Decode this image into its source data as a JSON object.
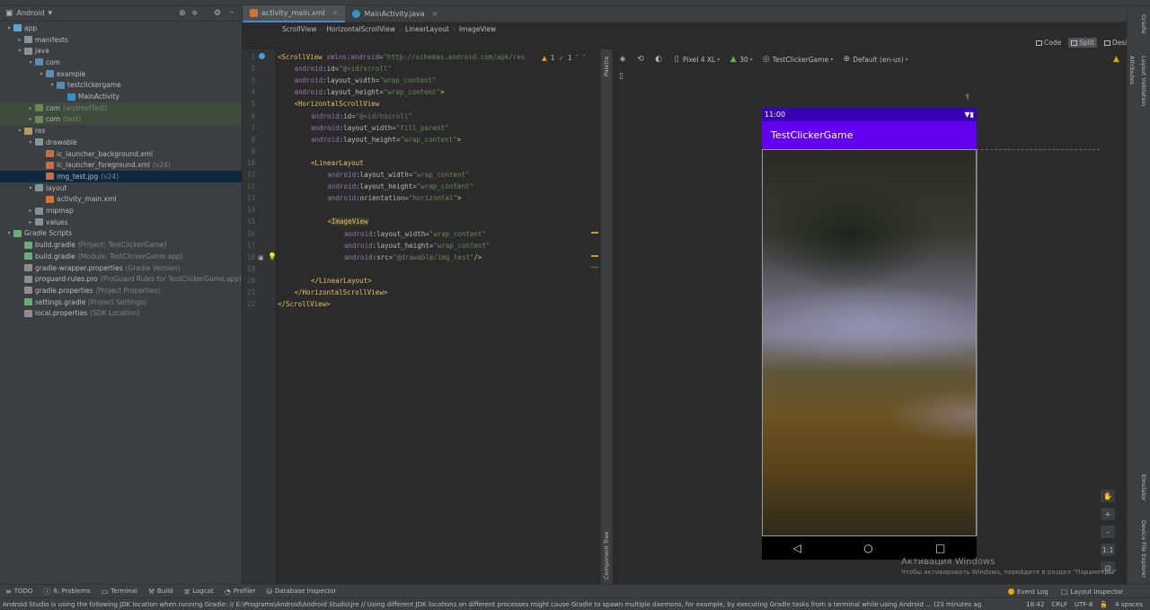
{
  "project_panel": {
    "view_selector": "Android",
    "tree": [
      {
        "label": "app",
        "sub": "",
        "depth": 0,
        "arrow": "▾",
        "icon": "app"
      },
      {
        "label": "manifests",
        "sub": "",
        "depth": 1,
        "arrow": "▸",
        "icon": "folder"
      },
      {
        "label": "java",
        "sub": "",
        "depth": 1,
        "arrow": "▾",
        "icon": "folder"
      },
      {
        "label": "com",
        "sub": "",
        "depth": 2,
        "arrow": "▾",
        "icon": "java"
      },
      {
        "label": "example",
        "sub": "",
        "depth": 3,
        "arrow": "▾",
        "icon": "java"
      },
      {
        "label": "testclickergame",
        "sub": "",
        "depth": 4,
        "arrow": "▾",
        "icon": "java"
      },
      {
        "label": "MainActivity",
        "sub": "",
        "depth": 5,
        "arrow": "",
        "icon": "class"
      },
      {
        "label": "com",
        "sub": "(androidTest)",
        "depth": 2,
        "arrow": "▸",
        "icon": "test",
        "hl": "green"
      },
      {
        "label": "com",
        "sub": "(test)",
        "depth": 2,
        "arrow": "▸",
        "icon": "test",
        "hl": "green"
      },
      {
        "label": "res",
        "sub": "",
        "depth": 1,
        "arrow": "▾",
        "icon": "res"
      },
      {
        "label": "drawable",
        "sub": "",
        "depth": 2,
        "arrow": "▾",
        "icon": "folder"
      },
      {
        "label": "ic_launcher_background.xml",
        "sub": "",
        "depth": 3,
        "arrow": "",
        "icon": "img"
      },
      {
        "label": "ic_launcher_foreground.xml",
        "sub": "(v24)",
        "depth": 3,
        "arrow": "",
        "icon": "img"
      },
      {
        "label": "img_test.jpg",
        "sub": "(v24)",
        "depth": 3,
        "arrow": "",
        "icon": "img",
        "hl": "blue"
      },
      {
        "label": "layout",
        "sub": "",
        "depth": 2,
        "arrow": "▾",
        "icon": "folder"
      },
      {
        "label": "activity_main.xml",
        "sub": "",
        "depth": 3,
        "arrow": "",
        "icon": "xml"
      },
      {
        "label": "mipmap",
        "sub": "",
        "depth": 2,
        "arrow": "▸",
        "icon": "folder"
      },
      {
        "label": "values",
        "sub": "",
        "depth": 2,
        "arrow": "▸",
        "icon": "folder"
      },
      {
        "label": "Gradle Scripts",
        "sub": "",
        "depth": 0,
        "arrow": "▾",
        "icon": "gradle"
      },
      {
        "label": "build.gradle",
        "sub": "(Project: TestClickerGame)",
        "depth": 1,
        "arrow": "",
        "icon": "gradle"
      },
      {
        "label": "build.gradle",
        "sub": "(Module: TestClickerGame.app)",
        "depth": 1,
        "arrow": "",
        "icon": "gradle"
      },
      {
        "label": "gradle-wrapper.properties",
        "sub": "(Gradle Version)",
        "depth": 1,
        "arrow": "",
        "icon": "props"
      },
      {
        "label": "proguard-rules.pro",
        "sub": "(ProGuard Rules for TestClickerGame.app)",
        "depth": 1,
        "arrow": "",
        "icon": "props"
      },
      {
        "label": "gradle.properties",
        "sub": "(Project Properties)",
        "depth": 1,
        "arrow": "",
        "icon": "props"
      },
      {
        "label": "settings.gradle",
        "sub": "(Project Settings)",
        "depth": 1,
        "arrow": "",
        "icon": "gradle"
      },
      {
        "label": "local.properties",
        "sub": "(SDK Location)",
        "depth": 1,
        "arrow": "",
        "icon": "props"
      }
    ]
  },
  "tabs": [
    {
      "label": "activity_main.xml",
      "icon": "xml",
      "active": true
    },
    {
      "label": "MainActivity.java",
      "icon": "java",
      "active": false
    }
  ],
  "breadcrumb": [
    "ScrollView",
    "HorizontalScrollView",
    "LinearLayout",
    "ImageView"
  ],
  "view_modes": {
    "code": "Code",
    "split": "Split",
    "design": "Design"
  },
  "inspections": {
    "warnings": "1",
    "ok": "1"
  },
  "code_lines": [
    {
      "n": "1",
      "indent": 0,
      "parts": [
        [
          "tag",
          "<ScrollView "
        ],
        [
          "ns",
          "xmlns:android"
        ],
        [
          "plain",
          "="
        ],
        [
          "val",
          "\"http://schemas.android.com/apk/res"
        ]
      ]
    },
    {
      "n": "2",
      "indent": 1,
      "parts": [
        [
          "ns",
          "android"
        ],
        [
          "attr",
          ":id="
        ],
        [
          "val",
          "\"@+id/scroll\""
        ]
      ]
    },
    {
      "n": "3",
      "indent": 1,
      "parts": [
        [
          "ns",
          "android"
        ],
        [
          "attr",
          ":layout_width="
        ],
        [
          "val",
          "\"wrap_content\""
        ]
      ]
    },
    {
      "n": "4",
      "indent": 1,
      "parts": [
        [
          "ns",
          "android"
        ],
        [
          "attr",
          ":layout_height="
        ],
        [
          "val",
          "\"wrap_content\""
        ],
        [
          "tag",
          ">"
        ]
      ]
    },
    {
      "n": "5",
      "indent": 1,
      "parts": [
        [
          "tag",
          "<HorizontalScrollView"
        ]
      ]
    },
    {
      "n": "6",
      "indent": 2,
      "parts": [
        [
          "ns",
          "android"
        ],
        [
          "attr",
          ":id="
        ],
        [
          "val",
          "\"@+id/hscroll\""
        ]
      ]
    },
    {
      "n": "7",
      "indent": 2,
      "parts": [
        [
          "ns",
          "android"
        ],
        [
          "attr",
          ":layout_width="
        ],
        [
          "val",
          "\"fill_parent\""
        ]
      ]
    },
    {
      "n": "8",
      "indent": 2,
      "parts": [
        [
          "ns",
          "android"
        ],
        [
          "attr",
          ":layout_height="
        ],
        [
          "val",
          "\"wrap_content\""
        ],
        [
          "tag",
          ">"
        ]
      ]
    },
    {
      "n": "9",
      "indent": 0,
      "parts": []
    },
    {
      "n": "10",
      "indent": 2,
      "parts": [
        [
          "tag",
          "<LinearLayout"
        ]
      ]
    },
    {
      "n": "11",
      "indent": 3,
      "parts": [
        [
          "ns",
          "android"
        ],
        [
          "attr",
          ":layout_width="
        ],
        [
          "val",
          "\"wrap_content\""
        ]
      ]
    },
    {
      "n": "12",
      "indent": 3,
      "parts": [
        [
          "ns",
          "android"
        ],
        [
          "attr",
          ":layout_height="
        ],
        [
          "val",
          "\"wrap_content\""
        ]
      ]
    },
    {
      "n": "13",
      "indent": 3,
      "parts": [
        [
          "ns",
          "android"
        ],
        [
          "attr",
          ":orientation="
        ],
        [
          "val",
          "\"horizontal\""
        ],
        [
          "tag",
          ">"
        ]
      ]
    },
    {
      "n": "14",
      "indent": 0,
      "parts": []
    },
    {
      "n": "15",
      "indent": 3,
      "parts": [
        [
          "tag",
          "<"
        ],
        [
          "taghl",
          "ImageView"
        ]
      ]
    },
    {
      "n": "16",
      "indent": 4,
      "parts": [
        [
          "ns",
          "android"
        ],
        [
          "attr",
          ":layout_width="
        ],
        [
          "val",
          "\"wrap_content\""
        ]
      ]
    },
    {
      "n": "17",
      "indent": 4,
      "parts": [
        [
          "ns",
          "android"
        ],
        [
          "attr",
          ":layout_height="
        ],
        [
          "val",
          "\"wrap_content\""
        ]
      ]
    },
    {
      "n": "18",
      "indent": 4,
      "parts": [
        [
          "ns",
          "android"
        ],
        [
          "attr",
          ":src="
        ],
        [
          "val",
          "\"@drawable/img_test\""
        ],
        [
          "tag",
          "/>"
        ]
      ]
    },
    {
      "n": "19",
      "indent": 0,
      "parts": []
    },
    {
      "n": "20",
      "indent": 2,
      "parts": [
        [
          "tag",
          "</LinearLayout>"
        ]
      ]
    },
    {
      "n": "21",
      "indent": 1,
      "parts": [
        [
          "tag",
          "</HorizontalScrollView>"
        ]
      ]
    },
    {
      "n": "22",
      "indent": 0,
      "parts": [
        [
          "tag",
          "</ScrollView>"
        ]
      ]
    }
  ],
  "palette_strip": {
    "palette": "Palette",
    "component_tree": "Component Tree"
  },
  "designer_toolbar": {
    "device": "Pixel 4 XL",
    "api": "30",
    "theme": "TestClickerGame",
    "locale": "Default (en-us)"
  },
  "phone": {
    "time": "11:00",
    "app_title": "TestClickerGame"
  },
  "zoom": {
    "one_to_one": "1:1"
  },
  "right_strip": {
    "gradle": "Gradle",
    "attributes": "Attributes",
    "layout_validation": "Layout Validation",
    "emulator": "Emulator",
    "device_file_explorer": "Device File Explorer"
  },
  "activation": {
    "title": "Активация Windows",
    "sub": "Чтобы активировать Windows, перейдите в раздел \"Параметры\""
  },
  "bottom_tools": [
    {
      "label": "TODO",
      "icon": "list-icon"
    },
    {
      "label": "6: Problems",
      "icon": "problems-icon"
    },
    {
      "label": "Terminal",
      "icon": "terminal-icon"
    },
    {
      "label": "Build",
      "icon": "hammer-icon"
    },
    {
      "label": "Logcat",
      "icon": "logcat-icon"
    },
    {
      "label": "Profiler",
      "icon": "profiler-icon"
    },
    {
      "label": "Database Inspector",
      "icon": "database-icon"
    }
  ],
  "bottom_tools_right": {
    "event_log": "Event Log",
    "layout_inspector": "Layout Inspector"
  },
  "status": {
    "message": "Android Studio is using the following JDK location when running Gradle: // E:\\Programs\\Android\\Android Studio\\jre // Using different JDK locations on different processes might cause Gradle to spawn multiple daemons, for example, by executing Gradle tasks from a terminal while using Android ... (23 minutes ag",
    "position": "18:42",
    "line_sep": "CRLF",
    "encoding": "UTF-8",
    "indent": "4 spaces"
  },
  "colors": {
    "status_bar": "#3700b3",
    "app_bar": "#6200ee",
    "selection": "#0d293e",
    "accent": "#4a88c7"
  }
}
